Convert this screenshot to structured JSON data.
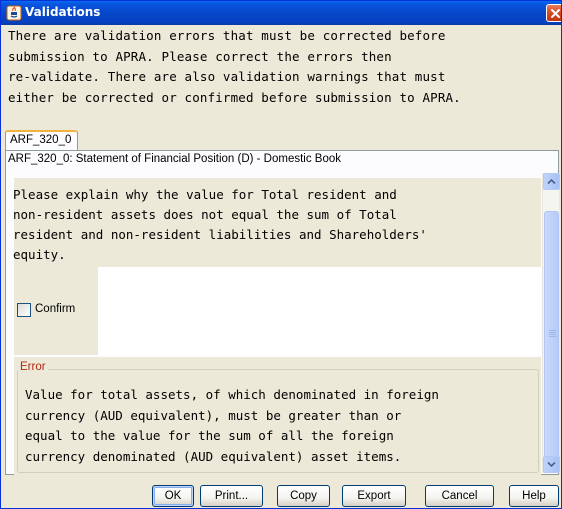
{
  "window": {
    "title": "Validations",
    "icon": "java-icon",
    "close_icon": "close-icon"
  },
  "message": "There are validation errors that must be corrected before\nsubmission to APRA. Please correct the errors then\nre-validate. There are also validation warnings that must\neither be corrected or confirmed before submission to APRA.",
  "tabs": [
    {
      "label": "ARF_320_0",
      "selected": true
    }
  ],
  "panel": {
    "header": "ARF_320_0: Statement of Financial Position (D) - Domestic Book",
    "warning": {
      "text": "Please explain why the value for Total resident and\nnon-resident assets does not equal the sum of Total\nresident and non-resident liabilities and Shareholders'\nequity.",
      "confirm_label": "Confirm",
      "confirm_checked": false,
      "explanation_value": ""
    },
    "error": {
      "legend": "Error",
      "text": "Value for total assets, of which denominated in foreign\ncurrency (AUD equivalent), must be greater than or\nequal to the value for the sum of all the foreign\ncurrency denominated (AUD equivalent) asset items."
    }
  },
  "buttons": {
    "ok": "OK",
    "print": "Print...",
    "copy": "Copy",
    "export": "Export",
    "cancel": "Cancel",
    "help": "Help"
  },
  "colors": {
    "titlebar": "#0747c9",
    "window_bg": "#ece9d8",
    "tab_accent": "#f2b43c",
    "error_legend": "#b02a12",
    "button_border": "#003c74"
  }
}
